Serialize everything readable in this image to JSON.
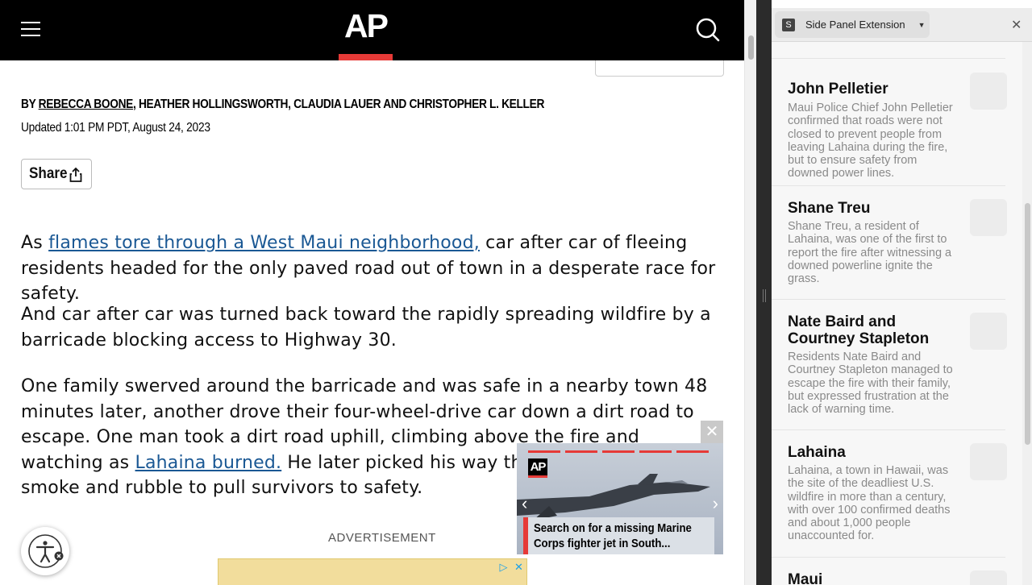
{
  "header": {
    "logo": "AP",
    "menu_icon": "hamburger-menu-icon",
    "search_icon": "search-icon",
    "brand_color": "#e63a37"
  },
  "article": {
    "byline_prefix": "BY ",
    "author_link": "REBECCA BOONE",
    "byline_rest": ", HEATHER HOLLINGSWORTH, CLAUDIA LAUER AND CHRISTOPHER L. KELLER",
    "updated": "Updated 1:01 PM PDT, August 24, 2023",
    "share_label": "Share",
    "p1_before": "As ",
    "p1_link": "flames tore through a West Maui neighborhood,",
    "p1_after": " car after car of fleeing residents headed for the only paved road out of town in a desperate race for safety.",
    "p2": "And car after car was turned back toward the rapidly spreading wildfire by a barricade blocking access to Highway 30.",
    "p3_before": "One family swerved around the barricade and was safe in a nearby town 48 minutes later, another drove their four-wheel-drive car down a dirt road to escape. One man took a dirt road uphill, climbing above the fire and watching as ",
    "p3_link": "Lahaina burned.",
    "p3_after": " He later picked his way through the flames, smoke and rubble to pull survivors to safety.",
    "link_color": "#1a5894"
  },
  "advertisement": {
    "label": "ADVERTISEMENT"
  },
  "video": {
    "logo": "AP",
    "close": "✕",
    "caption": "Search on for a missing Marine Corps fighter jet in South..."
  },
  "side_panel": {
    "extension_icon": "S",
    "extension_name": "Side Panel Extension",
    "close": "✕",
    "entries": [
      {
        "title": "John Pelletier",
        "desc": "Maui Police Chief John Pelletier confirmed that roads were not closed to prevent people from leaving Lahaina during the fire, but to ensure safety from downed power lines."
      },
      {
        "title": "Shane Treu",
        "desc": "Shane Treu, a resident of Lahaina, was one of the first to report the fire after witnessing a downed powerline ignite the grass."
      },
      {
        "title": "Nate Baird and Courtney Stapleton",
        "desc": "Residents Nate Baird and Courtney Stapleton managed to escape the fire with their family, but expressed frustration at the lack of warning time."
      },
      {
        "title": "Lahaina",
        "desc": "Lahaina, a town in Hawaii, was the site of the deadliest U.S. wildfire in more than a century, with over 100 confirmed deaths and about 1,000 people unaccounted for."
      },
      {
        "title": "Maui",
        "desc": ""
      }
    ]
  }
}
